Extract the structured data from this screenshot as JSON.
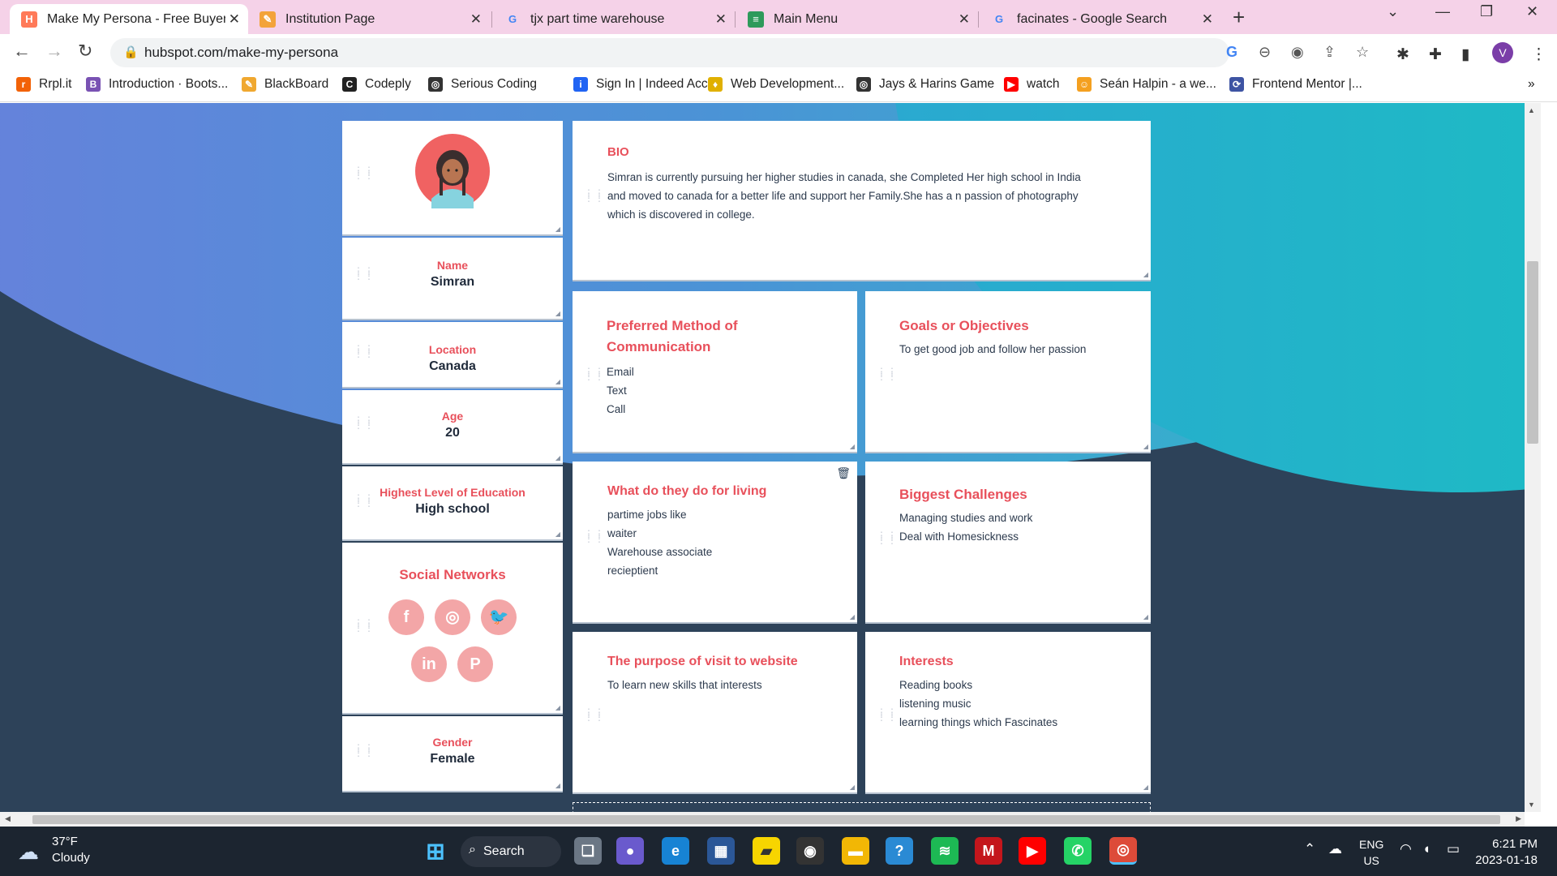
{
  "browser": {
    "tabs": [
      {
        "title": "Make My Persona - Free Buyer Pe",
        "favicon": "hubspot-icon",
        "color": "#ff7a59",
        "fav_text": "H",
        "active": true
      },
      {
        "title": "Institution Page",
        "favicon": "pencil-icon",
        "color": "#f3a33a",
        "fav_text": "✎",
        "active": false
      },
      {
        "title": "tjx part time warehouse",
        "favicon": "google-icon",
        "color": "#4285f4",
        "fav_text": "G",
        "active": false
      },
      {
        "title": "Main Menu",
        "favicon": "layers-icon",
        "color": "#2e9a5b",
        "fav_text": "≡",
        "active": false
      },
      {
        "title": "facinates - Google Search",
        "favicon": "google-icon",
        "color": "#4285f4",
        "fav_text": "G",
        "active": false
      }
    ],
    "url": "hubspot.com/make-my-persona",
    "profile_initial": "V",
    "bookmarks": [
      {
        "label": "Rrpl.it",
        "color": "#f26207",
        "icon": "r"
      },
      {
        "label": "Introduction · Boots...",
        "color": "#7952b3",
        "icon": "B"
      },
      {
        "label": "BlackBoard",
        "color": "#f0a830",
        "icon": "✎"
      },
      {
        "label": "Codeply",
        "color": "#222222",
        "icon": "C"
      },
      {
        "label": "Serious Coding",
        "color": "#333333",
        "icon": "◎"
      },
      {
        "label": "Sign In | Indeed Acc...",
        "color": "#2164f3",
        "icon": "i"
      },
      {
        "label": "Web Development...",
        "color": "#e0b000",
        "icon": "♦"
      },
      {
        "label": "Jays & Harins Game",
        "color": "#333333",
        "icon": "◎"
      },
      {
        "label": "watch",
        "color": "#ff0000",
        "icon": "▶"
      },
      {
        "label": "Seán Halpin - a we...",
        "color": "#f4a020",
        "icon": "☺"
      },
      {
        "label": "Frontend Mentor |...",
        "color": "#3e54a3",
        "icon": "⟳"
      }
    ]
  },
  "persona": {
    "name": {
      "label": "Name",
      "value": "Simran"
    },
    "location": {
      "label": "Location",
      "value": "Canada"
    },
    "age": {
      "label": "Age",
      "value": "20"
    },
    "education": {
      "label": "Highest Level of Education",
      "value": "High school"
    },
    "social": {
      "label": "Social Networks",
      "icons": [
        "facebook-icon",
        "instagram-icon",
        "twitter-icon",
        "linkedin-icon",
        "pinterest-icon"
      ],
      "glyphs": [
        "f",
        "◎",
        "🐦",
        "in",
        "P"
      ]
    },
    "gender": {
      "label": "Gender",
      "value": "Female"
    },
    "bio": {
      "title": "BIO",
      "text": "Simran is currently pursuing her higher studies in canada, she Completed Her high school in India and moved to canada for a better life and support her Family.She has a n passion of photography which is discovered in college."
    },
    "communication": {
      "title": "Preferred Method of Communication",
      "items": [
        "Email",
        "Text",
        "Call"
      ]
    },
    "goals": {
      "title": "Goals or Objectives",
      "text": "To get good job and follow her passion"
    },
    "living": {
      "title": "What do they do for living",
      "items": [
        "partime jobs like",
        "waiter",
        "Warehouse associate",
        "recieptient"
      ]
    },
    "challenges": {
      "title": "Biggest Challenges",
      "items": [
        "Managing studies and work",
        "Deal with Homesickness"
      ]
    },
    "purpose": {
      "title": "The purpose of visit to website",
      "text": "To learn new skills that interests"
    },
    "interests": {
      "title": "Interests",
      "items": [
        "Reading books",
        "listening music",
        "learning things which Fascinates"
      ]
    }
  },
  "taskbar": {
    "weather_temp": "37°F",
    "weather_desc": "Cloudy",
    "search_label": "Search",
    "lang": "ENG",
    "region": "US",
    "time": "6:21 PM",
    "date": "2023-01-18"
  }
}
